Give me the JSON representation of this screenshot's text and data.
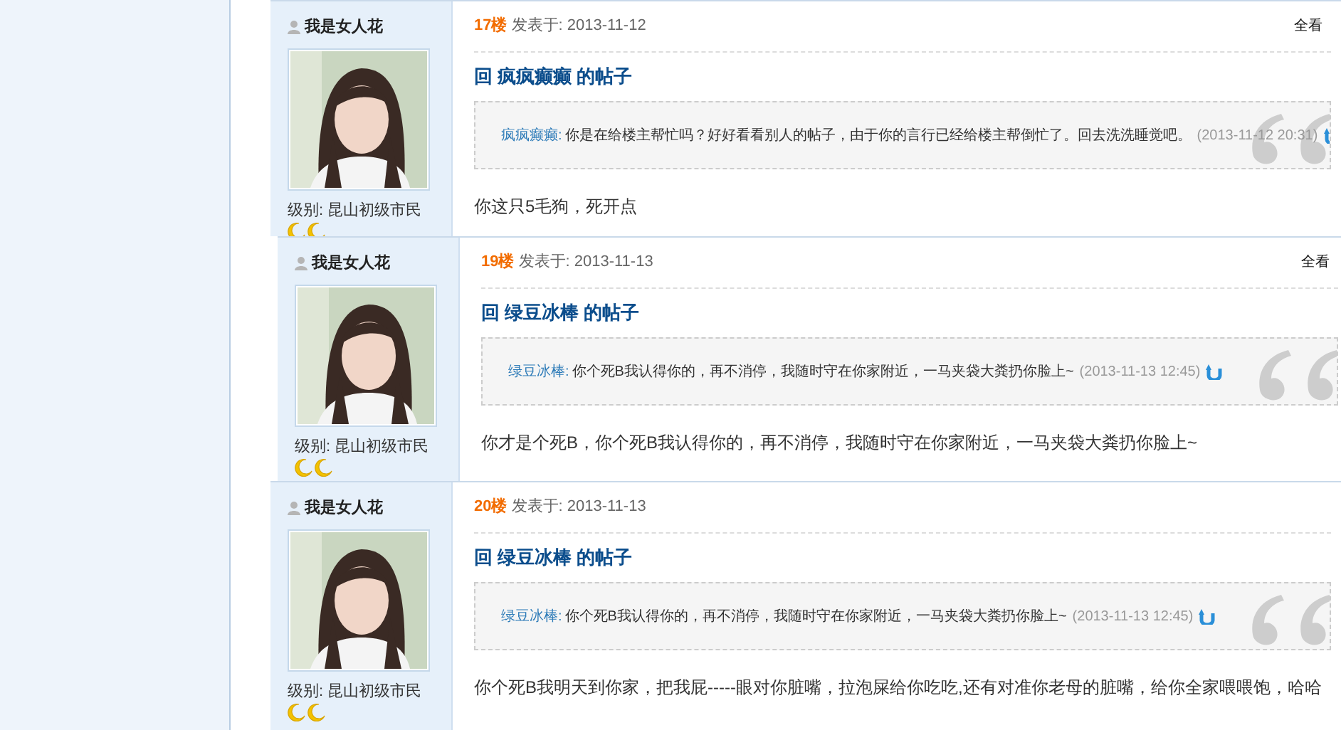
{
  "posts": [
    {
      "author": "我是女人花",
      "rank": "级别: 昆山初级市民",
      "floor": "17楼",
      "posted": "发表于: 2013-11-12",
      "view_all": "全看",
      "title": "回 疯疯癫癫 的帖子",
      "quote": {
        "author": "疯疯癫癫:",
        "text": "你是在给楼主帮忙吗？好好看看别人的帖子，由于你的言行已经给楼主帮倒忙了。回去洗洗睡觉吧。",
        "time": "(2013-11-12 20:31)"
      },
      "body": "你这只5毛狗，死开点"
    },
    {
      "author": "我是女人花",
      "rank": "级别: 昆山初级市民",
      "floor": "19楼",
      "posted": "发表于: 2013-11-13",
      "view_all": "全看",
      "title": "回 绿豆冰棒 的帖子",
      "quote": {
        "author": "绿豆冰棒:",
        "text": "你个死B我认得你的，再不消停，我随时守在你家附近，一马夹袋大粪扔你脸上~",
        "time": "(2013-11-13 12:45)"
      },
      "body": "你才是个死B，你个死B我认得你的，再不消停，我随时守在你家附近，一马夹袋大粪扔你脸上~"
    },
    {
      "author": "我是女人花",
      "rank": "级别: 昆山初级市民",
      "floor": "20楼",
      "posted": "发表于: 2013-11-13",
      "title": "回 绿豆冰棒 的帖子",
      "quote": {
        "author": "绿豆冰棒:",
        "text": "你个死B我认得你的，再不消停，我随时守在你家附近，一马夹袋大粪扔你脸上~",
        "time": "(2013-11-13 12:45)"
      },
      "body": "你个死B我明天到你家，把我屁-----眼对你脏嘴，拉泡屎给你吃吃,还有对准你老母的脏嘴，给你全家喂喂饱，哈哈"
    }
  ]
}
